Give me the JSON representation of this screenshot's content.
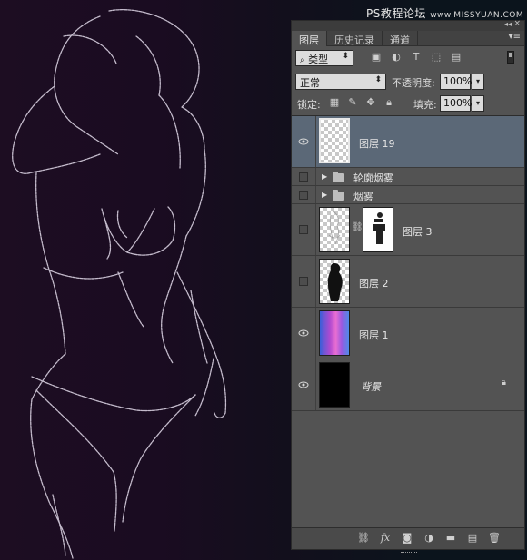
{
  "watermark": {
    "text": "PS教程论坛",
    "sub": "www.MISSYUAN.COM"
  },
  "panel": {
    "tabs": [
      {
        "label": "图层",
        "active": true
      },
      {
        "label": "历史记录",
        "active": false
      },
      {
        "label": "通道",
        "active": false
      }
    ],
    "filter": {
      "value": "类型"
    },
    "blend_mode": {
      "value": "正常"
    },
    "opacity": {
      "label": "不透明度:",
      "value": "100%"
    },
    "lock": {
      "label": "锁定:"
    },
    "fill": {
      "label": "填充:",
      "value": "100%"
    },
    "layers": [
      {
        "name": "图层 19",
        "type": "layer",
        "visible": true,
        "selected": true
      },
      {
        "name": "轮廓烟雾",
        "type": "group",
        "visible": false,
        "selected": false
      },
      {
        "name": "烟雾",
        "type": "group",
        "visible": false,
        "selected": false
      },
      {
        "name": "图层 3",
        "type": "layer-with-mask",
        "visible": false,
        "selected": false
      },
      {
        "name": "图层 2",
        "type": "layer",
        "visible": false,
        "selected": false
      },
      {
        "name": "图层 1",
        "type": "layer",
        "visible": true,
        "selected": false
      },
      {
        "name": "背景",
        "type": "background",
        "visible": true,
        "selected": false,
        "locked": true
      }
    ]
  },
  "colors": {
    "selection": "#5b6877",
    "panel": "#535353",
    "canvas_left": "#1d0d22",
    "canvas_right": "#0b141c"
  },
  "icons": [
    "search-icon",
    "image-filter-icon",
    "adjustment-filter-icon",
    "type-filter-icon",
    "shape-filter-icon",
    "smart-object-filter-icon",
    "lock-transparent-icon",
    "lock-brush-icon",
    "lock-move-icon",
    "lock-all-icon",
    "eye-icon",
    "folder-icon",
    "link-icon",
    "fx-icon",
    "mask-icon",
    "adjustment-icon",
    "new-group-icon",
    "new-layer-icon",
    "trash-icon"
  ]
}
